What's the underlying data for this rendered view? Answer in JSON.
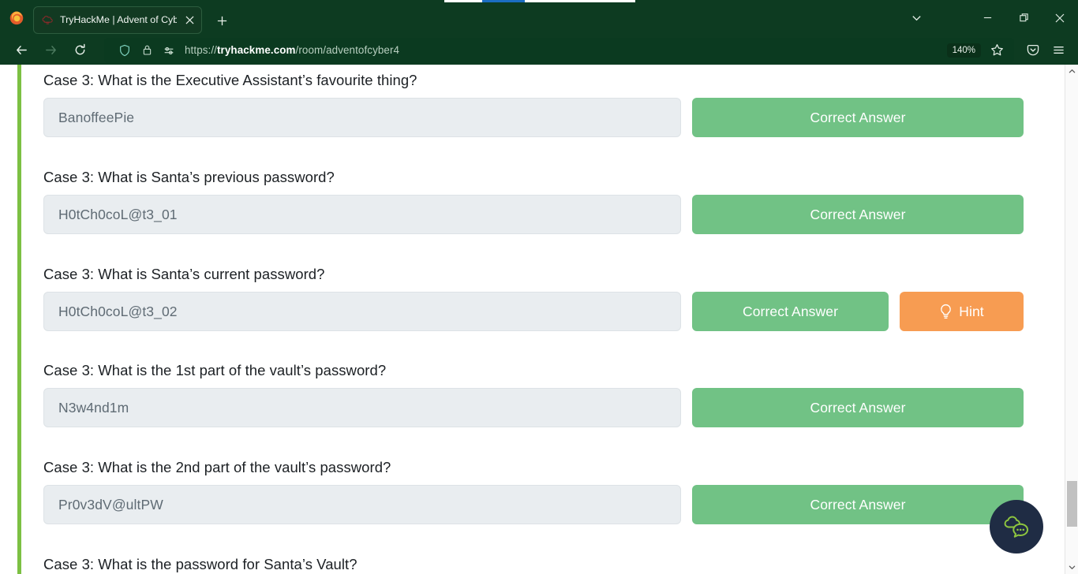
{
  "browser": {
    "window_controls": {
      "tablist_label": "List all tabs",
      "minimize_label": "Minimize",
      "restore_label": "Restore",
      "close_label": "Close"
    },
    "tab": {
      "title": "TryHackMe | Advent of Cyber ",
      "title_truncated": "20",
      "favicon": "tryhackme-cloud-icon",
      "close_label": "×"
    },
    "newtab_label": "+",
    "nav": {
      "back_label": "Back",
      "forward_label": "Forward",
      "reload_label": "Reload"
    },
    "urlbar": {
      "shield_icon": "shield-icon",
      "lock_icon": "lock-icon",
      "permissions_icon": "permissions-icon",
      "scheme": "https://",
      "domain": "tryhackme.com",
      "path": "/room/adventofcyber4",
      "zoom_level": "140%",
      "bookmark_icon": "star-icon",
      "pocket_icon": "pocket-save-icon",
      "menu_icon": "hamburger-menu-icon"
    }
  },
  "page": {
    "accent_color": "#7cc043",
    "questions": [
      {
        "label": "Case 3: What is the Executive Assistant’s favourite thing?",
        "answer": "BanoffeePie",
        "button_label": "Correct Answer",
        "has_hint": false
      },
      {
        "label": "Case 3: What is Santa’s previous password?",
        "answer": "H0tCh0coL@t3_01",
        "button_label": "Correct Answer",
        "has_hint": false
      },
      {
        "label": "Case 3: What is Santa’s current password?",
        "answer": "H0tCh0coL@t3_02",
        "button_label": "Correct Answer",
        "has_hint": true,
        "hint_label": "Hint",
        "hint_icon": "lightbulb-icon"
      },
      {
        "label": "Case 3: What is the 1st part of the vault’s password?",
        "answer": "N3w4nd1m",
        "button_label": "Correct Answer",
        "has_hint": false
      },
      {
        "label": "Case 3: What is the 2nd part of the vault’s password?",
        "answer": "Pr0v3dV@ultPW",
        "button_label": "Correct Answer",
        "has_hint": false
      },
      {
        "label": "Case 3: What is the password for Santa’s Vault?",
        "answer": "",
        "button_label": "",
        "has_hint": false
      }
    ],
    "chat_widget": {
      "icon": "chat-bubbles-icon",
      "background": "#1f2c44",
      "icon_color": "#8ec63f"
    }
  },
  "colors": {
    "chrome_green": "#0d3b21",
    "correct_green": "#71c285",
    "hint_orange": "#f79c52",
    "input_grey": "#e9edf0"
  }
}
